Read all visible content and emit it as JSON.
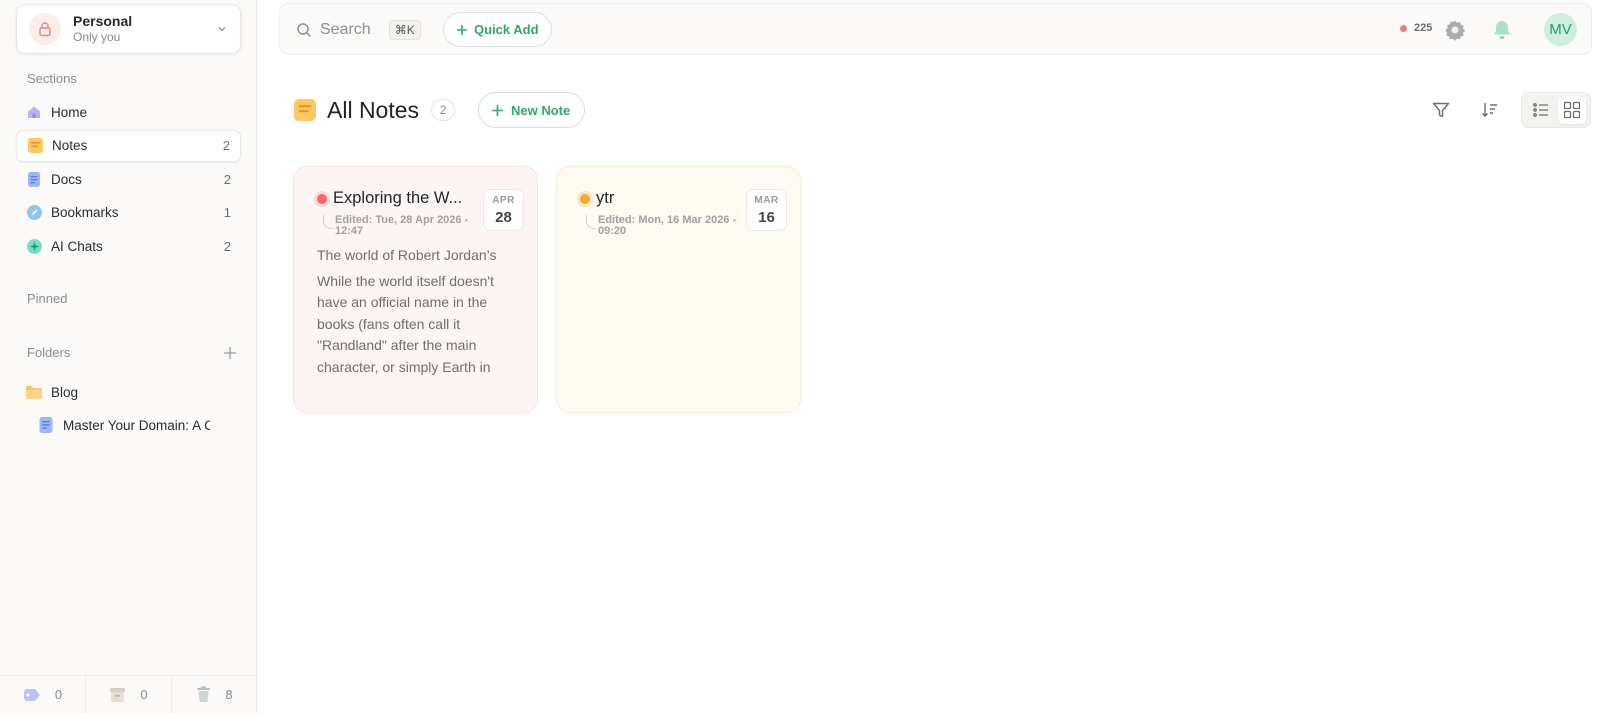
{
  "workspace": {
    "title": "Personal",
    "subtitle": "Only you"
  },
  "sidebar": {
    "sections_label": "Sections",
    "items": [
      {
        "label": "Home",
        "count": ""
      },
      {
        "label": "Notes",
        "count": "2"
      },
      {
        "label": "Docs",
        "count": "2"
      },
      {
        "label": "Bookmarks",
        "count": "1"
      },
      {
        "label": "AI Chats",
        "count": "2"
      }
    ],
    "pinned_label": "Pinned",
    "folders_label": "Folders",
    "folder": {
      "label": "Blog"
    },
    "doc": {
      "label": "Master Your Domain: A Co"
    },
    "footer": {
      "tags_count": "0",
      "archive_count": "0",
      "trash_count": "8"
    }
  },
  "topbar": {
    "search_placeholder": "Search",
    "shortcut": "⌘K",
    "quick_add": "Quick Add",
    "status_count": "225",
    "avatar_initials": "MV"
  },
  "header": {
    "title": "All Notes",
    "count": "2",
    "new_note": "New Note"
  },
  "notes": [
    {
      "title": "Exploring the W...",
      "edited": "Edited: Tue, 28 Apr 2026 - 12:47",
      "month": "APR",
      "day": "28",
      "body_1": "The world of Robert Jordan’s",
      "body_2": "While the world itself doesn't have an official name in the books (fans often call it \"Randland\" after the main character, or simply Earth in"
    },
    {
      "title": "ytr",
      "edited": "Edited: Mon, 16 Mar 2026 - 09:20",
      "month": "MAR",
      "day": "16"
    }
  ],
  "colors": {
    "accent": "#2fa86e",
    "red_dot": "#ef6b6b",
    "yellow_dot": "#f2a93b",
    "red_card_bg": "#fdf5f4",
    "yellow_card_bg": "#fffbf3"
  }
}
